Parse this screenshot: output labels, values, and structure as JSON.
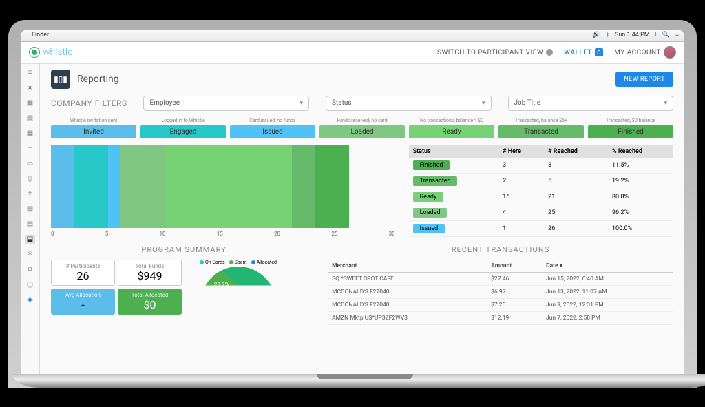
{
  "menubar": {
    "app": "Finder",
    "time": "Sun 1:44 PM"
  },
  "brand": {
    "name": "whistle",
    "color": "#22b573",
    "text_color": "#5bbeea"
  },
  "header": {
    "switch_view": "SWITCH TO PARTICIPANT VIEW",
    "wallet": "WALLET",
    "account": "MY ACCOUNT"
  },
  "page": {
    "title": "Reporting",
    "new_report": "NEW REPORT"
  },
  "filters": {
    "label": "COMPANY FILTERS",
    "selects": [
      "Employee",
      "Status",
      "Job Title"
    ]
  },
  "statuses": [
    {
      "hint": "Whistle invitation sent",
      "name": "Invited",
      "color": "#5bbeea"
    },
    {
      "hint": "Logged in to Whistle",
      "name": "Engaged",
      "color": "#27c8c8"
    },
    {
      "hint": "Card issued, no funds",
      "name": "Issued",
      "color": "#4fc3f7"
    },
    {
      "hint": "Funds received, no card",
      "name": "Loaded",
      "color": "#81c784"
    },
    {
      "hint": "No transactions, balance > $0",
      "name": "Ready",
      "color": "#76d275"
    },
    {
      "hint": "Transacted, balance $5+",
      "name": "Transacted",
      "color": "#66bb6a"
    },
    {
      "hint": "Transacted, $0 balance",
      "name": "Finished",
      "color": "#4caf50"
    }
  ],
  "chart_data": {
    "type": "bar",
    "title": "",
    "xlabel": "",
    "ylabel": "",
    "xlim": [
      0,
      30
    ],
    "ticks": [
      0,
      5,
      10,
      15,
      20,
      25,
      30
    ],
    "stacked_total": 26,
    "segments": [
      {
        "name": "Invited",
        "value": 2,
        "color": "#5bbeea"
      },
      {
        "name": "Engaged",
        "value": 3,
        "color": "#27c8c8"
      },
      {
        "name": "Issued",
        "value": 1,
        "color": "#4fc3f7"
      },
      {
        "name": "Loaded",
        "value": 4,
        "color": "#81c784"
      },
      {
        "name": "Ready",
        "value": 11,
        "color": "#76d275"
      },
      {
        "name": "Transacted",
        "value": 2,
        "color": "#66bb6a"
      },
      {
        "name": "Finished",
        "value": 3,
        "color": "#4caf50"
      }
    ],
    "pie": {
      "type": "pie",
      "title": "",
      "legend": [
        {
          "name": "On Cards",
          "color": "#27c8c8"
        },
        {
          "name": "Spent",
          "color": "#4caf50"
        },
        {
          "name": "Allocated",
          "color": "#1e88e5"
        }
      ],
      "slices": [
        {
          "name": "Spent",
          "pct": 23.2,
          "color": "#4caf50"
        },
        {
          "name": "On Cards",
          "pct": 76.8,
          "color": "#22b573"
        }
      ],
      "label": "23.2%"
    }
  },
  "status_table": {
    "headers": [
      "Status",
      "# Here",
      "# Reached",
      "% Reached"
    ],
    "rows": [
      {
        "status": "Finished",
        "color": "#4caf50",
        "here": "3",
        "reached": "3",
        "pct": "11.5%"
      },
      {
        "status": "Transacted",
        "color": "#66bb6a",
        "here": "2",
        "reached": "5",
        "pct": "19.2%"
      },
      {
        "status": "Ready",
        "color": "#76d275",
        "here": "16",
        "reached": "21",
        "pct": "80.8%"
      },
      {
        "status": "Loaded",
        "color": "#81c784",
        "here": "4",
        "reached": "25",
        "pct": "96.2%"
      },
      {
        "status": "Issued",
        "color": "#4fc3f7",
        "here": "1",
        "reached": "26",
        "pct": "100.0%"
      }
    ]
  },
  "summary": {
    "title": "PROGRAM SUMMARY",
    "blocks": [
      {
        "label": "# Participants",
        "value": "26"
      },
      {
        "label": "Total Funds",
        "value": "$949"
      },
      {
        "label": "Avg Allocation",
        "value": "-",
        "cls": "alloc"
      },
      {
        "label": "Total Allocated",
        "value": "$0",
        "cls": "totalloc"
      }
    ]
  },
  "transactions": {
    "title": "RECENT TRANSACTIONS",
    "headers": [
      "Merchant",
      "Amount",
      "Date ▾"
    ],
    "rows": [
      {
        "m": "SQ *SWEET SPOT CAFE",
        "a": "$27.46",
        "d": "Jun 15, 2022, 6:40 AM"
      },
      {
        "m": "MCDONALD'S F27040",
        "a": "$6.97",
        "d": "Jun 13, 2022, 11:07 AM"
      },
      {
        "m": "MCDONALD'S F27040",
        "a": "$7.20",
        "d": "Jun 9, 2022, 12:31 PM"
      },
      {
        "m": "AMZN Mktp US*UP3ZF2WV3",
        "a": "$12.19",
        "d": "Jun 7, 2022, 2:58 PM"
      }
    ]
  },
  "sidebar_icons": [
    "≡",
    "★",
    "▦",
    "▤",
    "▦",
    "—",
    "▭",
    "▯",
    "⌗",
    "▤",
    "▤",
    "⬓",
    "✉",
    "⚙",
    "▢",
    "◉"
  ]
}
